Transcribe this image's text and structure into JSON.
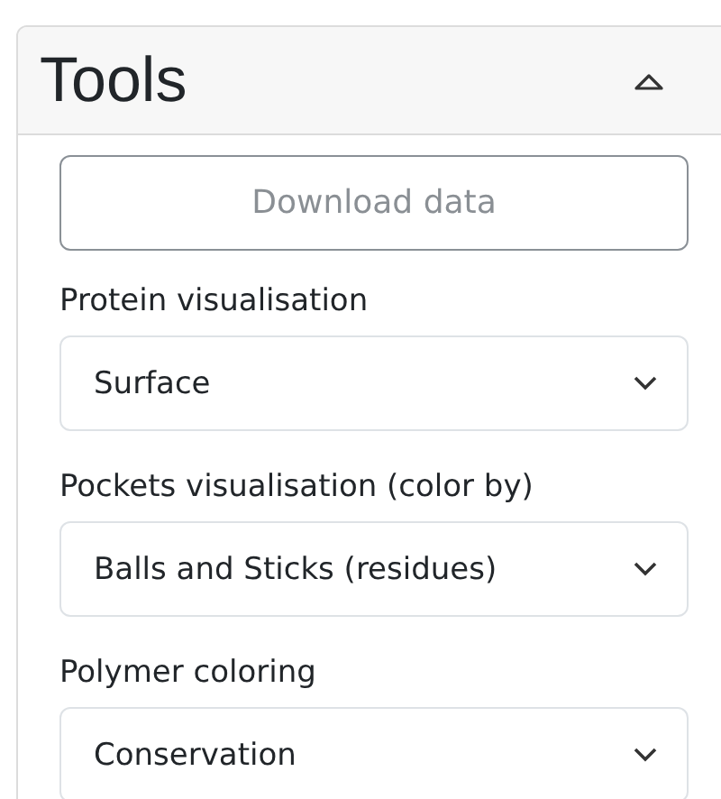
{
  "panel": {
    "title": "Tools",
    "expanded": true
  },
  "download_button": {
    "label": "Download data",
    "disabled": true
  },
  "selects": [
    {
      "label": "Protein visualisation",
      "value": "Surface"
    },
    {
      "label": "Pockets visualisation (color by)",
      "value": "Balls and Sticks (residues)"
    },
    {
      "label": "Polymer coloring",
      "value": "Conservation"
    }
  ]
}
